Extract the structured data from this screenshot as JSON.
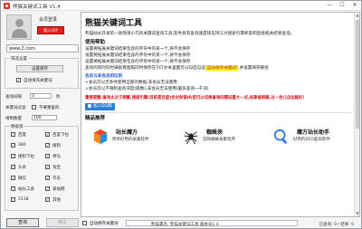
{
  "window": {
    "title": "熊猫关键词工具 V1.4",
    "min_label": "—",
    "max_label": "☐",
    "close_label": "✕"
  },
  "account": {
    "login_label": "会员登录",
    "vip_button": "加入VIP"
  },
  "search": {
    "value": "www.2.com"
  },
  "settings": {
    "group_title": "筛选设置",
    "save_button": "设置保存",
    "auto_fill_label": "自动填充关键词",
    "auto_fill_checked": true,
    "interval_label": "查询间隔",
    "interval_value": "3",
    "interval_unit": "秒",
    "filter_label": "关键词过滤",
    "filter_checked": false,
    "filter_option": "不要重复的",
    "count_label": "限制数量",
    "count_value": "100",
    "sources_group_title": "数据源",
    "sources": [
      {
        "label": "百度",
        "checked": true
      },
      {
        "label": "百度下拉",
        "checked": true
      },
      {
        "label": "360",
        "checked": true
      },
      {
        "label": "搜狗",
        "checked": true
      },
      {
        "label": "搜狗下拉",
        "checked": true
      },
      {
        "label": "神马",
        "checked": true
      },
      {
        "label": "头条",
        "checked": true
      },
      {
        "label": "淘宝",
        "checked": true
      },
      {
        "label": "微信",
        "checked": true
      },
      {
        "label": "京东",
        "checked": true
      },
      {
        "label": "站长工具",
        "checked": true
      },
      {
        "label": "爱站网",
        "checked": true
      },
      {
        "label": "5118",
        "checked": true
      },
      {
        "label": "其他",
        "checked": true
      }
    ]
  },
  "actions": {
    "query_button": "查询",
    "stop_button": "停止"
  },
  "content": {
    "title": "熊猫关键词工具",
    "intro": "熊猫站长开发的一款简单小巧的关键词查询工具,软件具有查询速度快支持三大搜索引擎抓取和直接拓关结果查询。",
    "help_heading": "使用帮助",
    "help_lines": [
      "设置要拓展关键词结果包含的字符中的某一个,将不会保存",
      "设置要拓展关键词结果包含的字符中的某一个,将不会保存",
      "设置要拓展关键词结果包含的字符中的某一个,将不会保存"
    ],
    "help_last_prefix": "查询的同时同时满屏看图再同时保存在TXT文本里面可以勾选勾选",
    "help_last_highlight": "\"自动保存关键词\"",
    "help_last_suffix": ",并设置保存路径",
    "vip_heading": "会员与非会员的区别",
    "vip_lines": [
      ">会员可以无条件使用全部的数据,非会员无法使用",
      ">会员可以不限制查询深度(级数),非会员无法使用(最多查询一千词)"
    ],
    "warning": "重要提醒:查询太过于频繁,搜索引擎(目前是百度)会对封锁IP,您可以切换查询间隔设置大一点,如果被屏蔽,过一会儿自动就好!",
    "qq_button": "加入QQ群",
    "recommend_heading": "精品推荐",
    "cards": [
      {
        "name": "站长魔方",
        "desc": "简单好用的采集软件"
      },
      {
        "name": "蜘蛛侠",
        "desc": "首款蜘蛛采集程序"
      },
      {
        "name": "魔方站长助手",
        "desc": "好用的SEO查询软件"
      }
    ]
  },
  "bottom": {
    "auto_save_label": "自动保存关键词",
    "auto_save_checked": false,
    "status_text": "熊猫署名: 熊猫关键词工具 版本号1.4",
    "status_right": "已查询: 0 / 结果: 0"
  }
}
